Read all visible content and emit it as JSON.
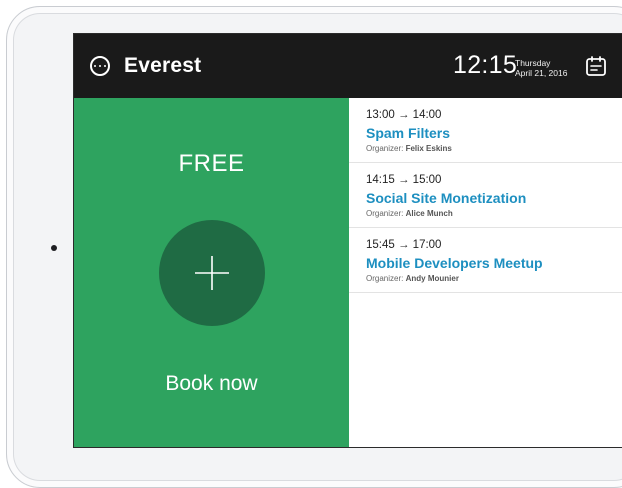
{
  "header": {
    "room_name": "Everest",
    "time": "12:15",
    "weekday": "Thursday",
    "date": "April 21, 2016",
    "menu_icon": "ellipsis-circle-icon",
    "calendar_icon": "calendar-icon"
  },
  "status": {
    "label": "FREE",
    "action_label": "Book now",
    "color": "#2ea35f",
    "button_color": "#1f6b44"
  },
  "meetings": [
    {
      "time": "13:00 → 14:00",
      "title": "Spam Filters",
      "organizer_label": "Organizer:",
      "organizer": "Felix Eskins"
    },
    {
      "time": "14:15 → 15:00",
      "title": "Social Site Monetization",
      "organizer_label": "Organizer:",
      "organizer": "Alice Munch"
    },
    {
      "time": "15:45 → 17:00",
      "title": "Mobile Developers Meetup",
      "organizer_label": "Organizer:",
      "organizer": "Andy Mounier"
    }
  ],
  "colors": {
    "accent": "#1d8fc0",
    "header_bg": "#1a1a1a"
  }
}
